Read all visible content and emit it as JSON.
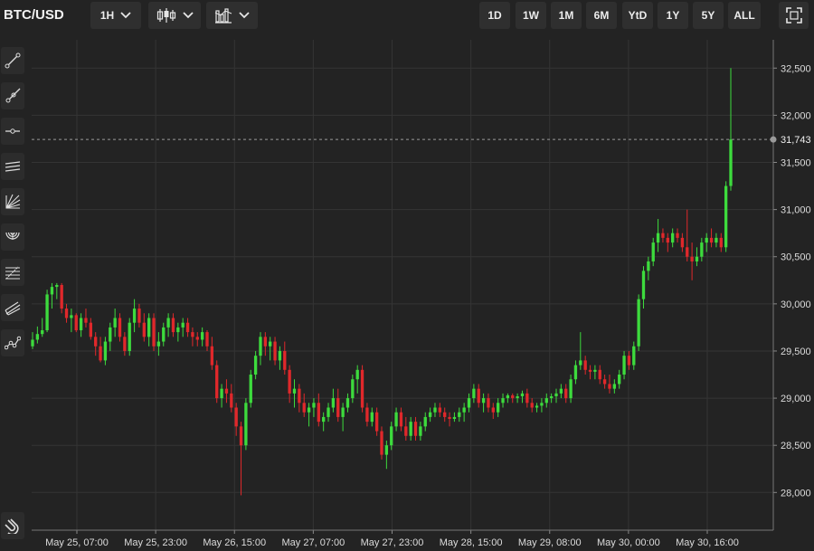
{
  "header": {
    "symbol": "BTC/USD",
    "interval": "1H",
    "ranges": [
      "1D",
      "1W",
      "1M",
      "6M",
      "YtD",
      "1Y",
      "5Y",
      "ALL"
    ]
  },
  "toolbar_icons": [
    "interval-chevron-icon",
    "candlestick-icon",
    "chart-style-chevron-icon",
    "bar-chart-icon",
    "bar-chart-chevron-icon",
    "fullscreen-icon"
  ],
  "sidebar_tools": [
    "trend-line-icon",
    "ray-line-icon",
    "horizontal-line-icon",
    "parallel-channel-icon",
    "fibonacci-fan-icon",
    "fibonacci-arc-icon",
    "fibonacci-retracement-icon",
    "pitchfork-icon",
    "multi-point-line-icon"
  ],
  "sidebar_bottom_tool": "magnet-icon",
  "colors": {
    "background": "#232323",
    "up": "#3ddb3d",
    "down": "#e0282b",
    "grid": "#343434",
    "axis_text": "#dcdcdc"
  },
  "chart_data": {
    "type": "candlestick",
    "series_name": "BTC/USD",
    "interval": "1H",
    "x_tick_labels": [
      "May 25, 07:00",
      "May 25, 23:00",
      "May 26, 15:00",
      "May 27, 07:00",
      "May 27, 23:00",
      "May 28, 15:00",
      "May 29, 08:00",
      "May 30, 00:00",
      "May 30, 16:00"
    ],
    "y_ticks": [
      28000,
      28500,
      29000,
      29500,
      30000,
      30500,
      31000,
      31500,
      32000,
      32500
    ],
    "y_tick_labels": [
      "28,000",
      "28,500",
      "29,000",
      "29,500",
      "30,000",
      "30,500",
      "31,000",
      "31,500",
      "32,000",
      "32,500"
    ],
    "ylim": [
      27600,
      32800
    ],
    "last_price": 31743,
    "last_price_label": "31,743",
    "grid": true,
    "ohlc": [
      [
        29550,
        29700,
        29520,
        29620
      ],
      [
        29620,
        29760,
        29580,
        29680
      ],
      [
        29680,
        29850,
        29650,
        29720
      ],
      [
        29720,
        30150,
        29700,
        30100
      ],
      [
        30100,
        30220,
        29950,
        30180
      ],
      [
        30180,
        30220,
        30050,
        30200
      ],
      [
        30200,
        30220,
        29900,
        29950
      ],
      [
        29950,
        30000,
        29800,
        29850
      ],
      [
        29850,
        29950,
        29700,
        29880
      ],
      [
        29880,
        29900,
        29700,
        29720
      ],
      [
        29720,
        29900,
        29650,
        29850
      ],
      [
        29850,
        29950,
        29750,
        29800
      ],
      [
        29800,
        29850,
        29620,
        29650
      ],
      [
        29650,
        29700,
        29450,
        29550
      ],
      [
        29550,
        29650,
        29380,
        29400
      ],
      [
        29400,
        29650,
        29350,
        29600
      ],
      [
        29600,
        29800,
        29500,
        29750
      ],
      [
        29750,
        29950,
        29650,
        29850
      ],
      [
        29850,
        29900,
        29600,
        29650
      ],
      [
        29650,
        29700,
        29450,
        29500
      ],
      [
        29500,
        29850,
        29450,
        29800
      ],
      [
        29800,
        30050,
        29700,
        29950
      ],
      [
        29950,
        30000,
        29750,
        29800
      ],
      [
        29800,
        29900,
        29600,
        29650
      ],
      [
        29650,
        29900,
        29550,
        29850
      ],
      [
        29850,
        29900,
        29500,
        29550
      ],
      [
        29550,
        29700,
        29450,
        29600
      ],
      [
        29600,
        29800,
        29550,
        29750
      ],
      [
        29750,
        29900,
        29650,
        29850
      ],
      [
        29850,
        29900,
        29650,
        29700
      ],
      [
        29700,
        29800,
        29600,
        29750
      ],
      [
        29750,
        29850,
        29650,
        29800
      ],
      [
        29800,
        29850,
        29650,
        29700
      ],
      [
        29700,
        29750,
        29550,
        29650
      ],
      [
        29650,
        29700,
        29550,
        29620
      ],
      [
        29620,
        29750,
        29550,
        29700
      ],
      [
        29700,
        29720,
        29500,
        29550
      ],
      [
        29550,
        29650,
        29300,
        29350
      ],
      [
        29350,
        29400,
        28950,
        29000
      ],
      [
        29000,
        29150,
        28900,
        29100
      ],
      [
        29100,
        29200,
        28950,
        29050
      ],
      [
        29050,
        29150,
        28850,
        28900
      ],
      [
        28900,
        28950,
        28600,
        28700
      ],
      [
        28700,
        28750,
        27970,
        28500
      ],
      [
        28500,
        29000,
        28450,
        28950
      ],
      [
        28950,
        29300,
        28900,
        29250
      ],
      [
        29250,
        29500,
        29200,
        29450
      ],
      [
        29450,
        29700,
        29350,
        29650
      ],
      [
        29650,
        29700,
        29450,
        29550
      ],
      [
        29550,
        29650,
        29400,
        29600
      ],
      [
        29600,
        29650,
        29350,
        29400
      ],
      [
        29400,
        29550,
        29300,
        29500
      ],
      [
        29500,
        29600,
        29250,
        29300
      ],
      [
        29300,
        29350,
        28950,
        29050
      ],
      [
        29050,
        29200,
        28900,
        29100
      ],
      [
        29100,
        29150,
        28850,
        28950
      ],
      [
        28950,
        29050,
        28800,
        28850
      ],
      [
        28850,
        28950,
        28700,
        28900
      ],
      [
        28900,
        29000,
        28800,
        28950
      ],
      [
        28950,
        29050,
        28700,
        28750
      ],
      [
        28750,
        28850,
        28650,
        28800
      ],
      [
        28800,
        28950,
        28750,
        28900
      ],
      [
        28900,
        29100,
        28850,
        29000
      ],
      [
        29000,
        29100,
        28750,
        28800
      ],
      [
        28800,
        28950,
        28650,
        28900
      ],
      [
        28900,
        29050,
        28850,
        29000
      ],
      [
        29000,
        29250,
        28950,
        29200
      ],
      [
        29200,
        29350,
        29050,
        29300
      ],
      [
        29300,
        29350,
        28850,
        28900
      ],
      [
        28900,
        28950,
        28700,
        28750
      ],
      [
        28750,
        28900,
        28700,
        28850
      ],
      [
        28850,
        28900,
        28600,
        28650
      ],
      [
        28650,
        28700,
        28350,
        28400
      ],
      [
        28400,
        28550,
        28250,
        28500
      ],
      [
        28500,
        28750,
        28450,
        28700
      ],
      [
        28700,
        28900,
        28650,
        28850
      ],
      [
        28850,
        28900,
        28650,
        28700
      ],
      [
        28700,
        28800,
        28550,
        28600
      ],
      [
        28600,
        28800,
        28550,
        28750
      ],
      [
        28750,
        28800,
        28550,
        28600
      ],
      [
        28600,
        28750,
        28550,
        28700
      ],
      [
        28700,
        28850,
        28650,
        28800
      ],
      [
        28800,
        28900,
        28750,
        28850
      ],
      [
        28850,
        28950,
        28800,
        28900
      ],
      [
        28900,
        28950,
        28800,
        28850
      ],
      [
        28850,
        28900,
        28750,
        28800
      ],
      [
        28800,
        28850,
        28700,
        28780
      ],
      [
        28780,
        28850,
        28750,
        28800
      ],
      [
        28800,
        28900,
        28750,
        28850
      ],
      [
        28850,
        28950,
        28750,
        28900
      ],
      [
        28900,
        29050,
        28850,
        29000
      ],
      [
        29000,
        29150,
        28950,
        29100
      ],
      [
        29100,
        29150,
        28900,
        28950
      ],
      [
        28950,
        29050,
        28850,
        29000
      ],
      [
        29000,
        29050,
        28850,
        28900
      ],
      [
        28900,
        28950,
        28780,
        28850
      ],
      [
        28850,
        29000,
        28800,
        28950
      ],
      [
        28950,
        29050,
        28900,
        29000
      ],
      [
        29000,
        29050,
        28950,
        29030
      ],
      [
        29030,
        29050,
        28950,
        29000
      ],
      [
        29000,
        29050,
        28950,
        29020
      ],
      [
        29020,
        29080,
        28950,
        29050
      ],
      [
        29050,
        29100,
        28900,
        28950
      ],
      [
        28950,
        29000,
        28850,
        28900
      ],
      [
        28900,
        28950,
        28850,
        28920
      ],
      [
        28920,
        29000,
        28850,
        28950
      ],
      [
        28950,
        29050,
        28900,
        29000
      ],
      [
        29000,
        29050,
        28950,
        29020
      ],
      [
        29020,
        29100,
        28950,
        29050
      ],
      [
        29050,
        29150,
        29000,
        29100
      ],
      [
        29100,
        29150,
        28950,
        29000
      ],
      [
        29000,
        29250,
        28950,
        29200
      ],
      [
        29200,
        29400,
        29150,
        29350
      ],
      [
        29350,
        29700,
        29300,
        29400
      ],
      [
        29400,
        29450,
        29250,
        29300
      ],
      [
        29300,
        29350,
        29200,
        29280
      ],
      [
        29280,
        29350,
        29200,
        29300
      ],
      [
        29300,
        29350,
        29150,
        29200
      ],
      [
        29200,
        29250,
        29100,
        29150
      ],
      [
        29150,
        29250,
        29050,
        29100
      ],
      [
        29100,
        29200,
        29050,
        29150
      ],
      [
        29150,
        29300,
        29100,
        29250
      ],
      [
        29250,
        29500,
        29200,
        29450
      ],
      [
        29450,
        29500,
        29300,
        29350
      ],
      [
        29350,
        29600,
        29300,
        29550
      ],
      [
        29550,
        30100,
        29500,
        30050
      ],
      [
        30050,
        30400,
        29950,
        30350
      ],
      [
        30350,
        30500,
        30250,
        30450
      ],
      [
        30450,
        30700,
        30400,
        30650
      ],
      [
        30650,
        30900,
        30550,
        30750
      ],
      [
        30750,
        30800,
        30650,
        30700
      ],
      [
        30700,
        30750,
        30550,
        30650
      ],
      [
        30650,
        30800,
        30600,
        30750
      ],
      [
        30750,
        30800,
        30650,
        30700
      ],
      [
        30700,
        30750,
        30550,
        30600
      ],
      [
        30600,
        31000,
        30450,
        30500
      ],
      [
        30500,
        30650,
        30250,
        30450
      ],
      [
        30450,
        30600,
        30400,
        30500
      ],
      [
        30500,
        30700,
        30450,
        30650
      ],
      [
        30650,
        30750,
        30550,
        30700
      ],
      [
        30700,
        30800,
        30600,
        30650
      ],
      [
        30650,
        30750,
        30600,
        30700
      ],
      [
        30700,
        30750,
        30550,
        30600
      ],
      [
        30600,
        31300,
        30550,
        31250
      ],
      [
        31250,
        32500,
        31200,
        31743
      ]
    ]
  }
}
